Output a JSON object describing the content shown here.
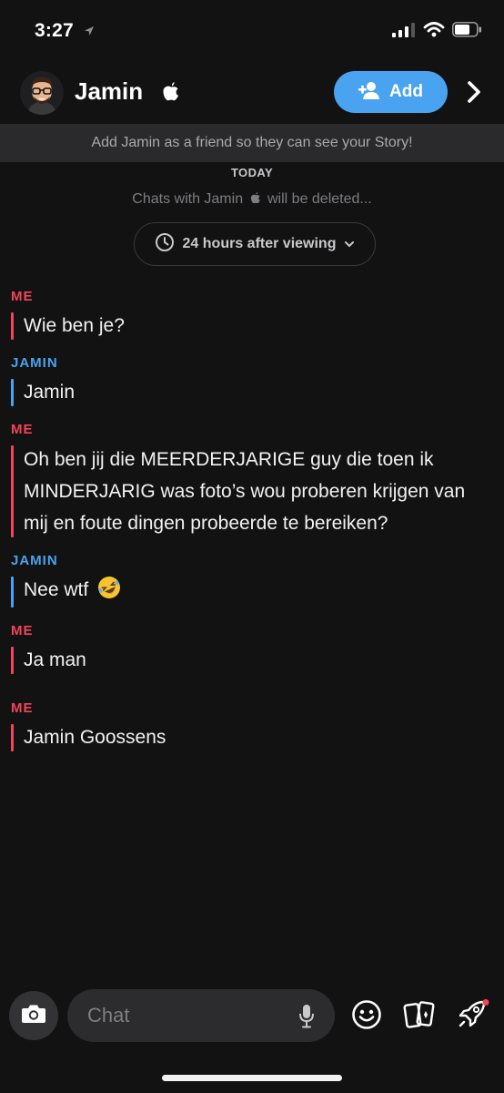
{
  "status_bar": {
    "time": "3:27"
  },
  "header": {
    "contact_name": "Jamin",
    "add_label": "Add"
  },
  "banner": {
    "text": "Add Jamin as a friend so they can see your Story!"
  },
  "chat_meta": {
    "date_label": "TODAY",
    "deletion_prefix": "Chats with Jamin",
    "deletion_suffix": "will be deleted...",
    "timer_label": "24 hours after viewing"
  },
  "messages": [
    {
      "sender": "ME",
      "text": "Wie ben je?",
      "from": "me"
    },
    {
      "sender": "JAMIN",
      "text": "Jamin",
      "from": "them"
    },
    {
      "sender": "ME",
      "text": "Oh ben jij die MEERDERJARIGE guy die toen ik MINDERJARIG was foto’s wou proberen krijgen van mij en foute dingen probeerde te bereiken?",
      "from": "me"
    },
    {
      "sender": "JAMIN",
      "text": "Nee wtf",
      "from": "them",
      "emoji": "rolling-on-floor-laughing"
    },
    {
      "sender": "ME",
      "text": "Ja man",
      "from": "me"
    },
    {
      "sender": "ME",
      "text": "Jamin Goossens",
      "from": "me"
    }
  ],
  "composer": {
    "placeholder": "Chat"
  },
  "colors": {
    "me": "#f0455a",
    "them": "#4aa3f0",
    "add_button": "#4aa3f0",
    "background": "#121212"
  },
  "icons": [
    "location-arrow-icon",
    "signal-icon",
    "wifi-icon",
    "battery-icon",
    "apple-icon",
    "add-friend-icon",
    "chevron-right-icon",
    "clock-icon",
    "chevron-down-icon",
    "camera-icon",
    "microphone-icon",
    "smiley-icon",
    "cards-icon",
    "rocket-icon"
  ]
}
